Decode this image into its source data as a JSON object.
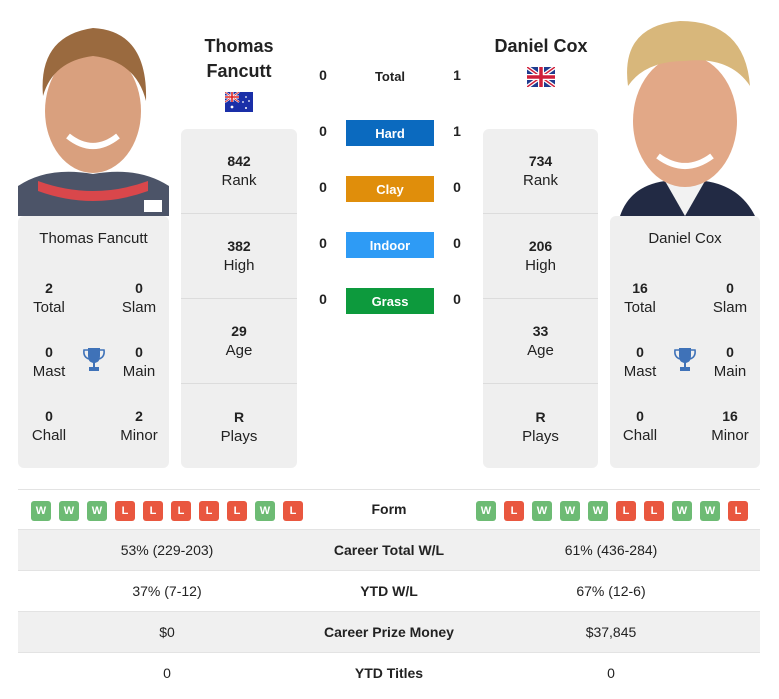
{
  "player1": {
    "name": "Thomas Fancutt",
    "name_line1": "Thomas",
    "name_line2": "Fancutt",
    "country_flag": "australia-flag",
    "rank": "842",
    "rank_label": "Rank",
    "high": "382",
    "high_label": "High",
    "age": "29",
    "age_label": "Age",
    "plays": "R",
    "plays_label": "Plays",
    "titles": {
      "total": "2",
      "total_label": "Total",
      "slam": "0",
      "slam_label": "Slam",
      "mast": "0",
      "mast_label": "Mast",
      "main": "0",
      "main_label": "Main",
      "chall": "0",
      "chall_label": "Chall",
      "minor": "2",
      "minor_label": "Minor"
    },
    "form": [
      "W",
      "W",
      "W",
      "L",
      "L",
      "L",
      "L",
      "L",
      "W",
      "L"
    ]
  },
  "player2": {
    "name": "Daniel Cox",
    "country_flag": "uk-flag",
    "rank": "734",
    "rank_label": "Rank",
    "high": "206",
    "high_label": "High",
    "age": "33",
    "age_label": "Age",
    "plays": "R",
    "plays_label": "Plays",
    "titles": {
      "total": "16",
      "total_label": "Total",
      "slam": "0",
      "slam_label": "Slam",
      "mast": "0",
      "mast_label": "Mast",
      "main": "0",
      "main_label": "Main",
      "chall": "0",
      "chall_label": "Chall",
      "minor": "16",
      "minor_label": "Minor"
    },
    "form": [
      "W",
      "L",
      "W",
      "W",
      "W",
      "L",
      "L",
      "W",
      "W",
      "L"
    ]
  },
  "h2h": {
    "total_label": "Total",
    "p1_total": "0",
    "p2_total": "1",
    "surfaces": [
      {
        "label": "Hard",
        "p1": "0",
        "p2": "1",
        "color": "#0b6abf"
      },
      {
        "label": "Clay",
        "p1": "0",
        "p2": "0",
        "color": "#e08e0b"
      },
      {
        "label": "Indoor",
        "p1": "0",
        "p2": "0",
        "color": "#2e9bf5"
      },
      {
        "label": "Grass",
        "p1": "0",
        "p2": "0",
        "color": "#0d9a3d"
      }
    ]
  },
  "form_label": "Form",
  "comparison": [
    {
      "label": "Career Total W/L",
      "p1": "53% (229-203)",
      "p2": "61% (436-284)"
    },
    {
      "label": "YTD W/L",
      "p1": "37% (7-12)",
      "p2": "67% (12-6)"
    },
    {
      "label": "Career Prize Money",
      "p1": "$0",
      "p2": "$37,845"
    },
    {
      "label": "YTD Titles",
      "p1": "0",
      "p2": "0"
    }
  ],
  "icons": {
    "trophy": "trophy-icon",
    "photo": "player-photo"
  }
}
